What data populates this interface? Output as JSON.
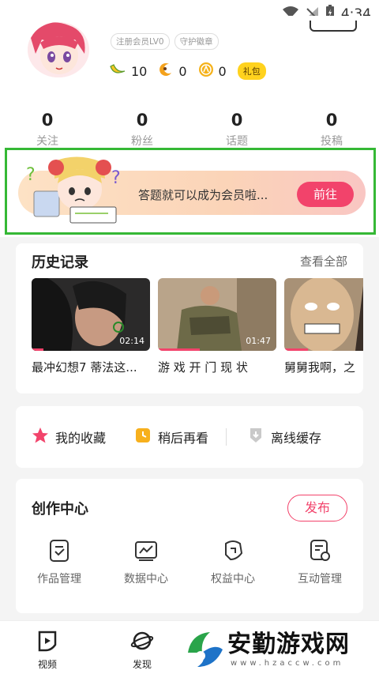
{
  "status": {
    "time": "4:34"
  },
  "profile": {
    "badges": [
      "注册会员LV0",
      "守护徽章"
    ],
    "wallet": [
      {
        "icon": "banana-icon",
        "value": "10"
      },
      {
        "icon": "moon-cake-icon",
        "value": "0"
      },
      {
        "icon": "coin-icon",
        "value": "0"
      }
    ],
    "gift_label": "礼包",
    "stats": [
      {
        "value": "0",
        "label": "关注"
      },
      {
        "value": "0",
        "label": "粉丝"
      },
      {
        "value": "0",
        "label": "话题"
      },
      {
        "value": "0",
        "label": "投稿"
      }
    ]
  },
  "promo": {
    "text": "答题就可以成为会员啦...",
    "button": "前往"
  },
  "history": {
    "title": "历史记录",
    "more": "查看全部",
    "items": [
      {
        "title": "最冲幻想7 蒂法这...",
        "duration": "02:14",
        "progress": 0.1
      },
      {
        "title": "游 戏 开 门 现 状",
        "duration": "01:47",
        "progress": 0.35
      },
      {
        "title": "舅舅我啊，之",
        "duration": "",
        "progress": 0.2
      }
    ]
  },
  "quick": [
    {
      "label": "我的收藏",
      "icon": "star-icon"
    },
    {
      "label": "稍后再看",
      "icon": "clock-icon"
    },
    {
      "label": "离线缓存",
      "icon": "download-icon"
    }
  ],
  "create": {
    "title": "创作中心",
    "publish": "发布",
    "tools": [
      {
        "label": "作品管理",
        "icon": "works-icon"
      },
      {
        "label": "数据中心",
        "icon": "chart-icon"
      },
      {
        "label": "权益中心",
        "icon": "rights-icon"
      },
      {
        "label": "互动管理",
        "icon": "interaction-icon"
      }
    ]
  },
  "tabs": [
    {
      "label": "视频",
      "icon": "video-tab-icon"
    },
    {
      "label": "发现",
      "icon": "planet-tab-icon"
    }
  ],
  "watermark": {
    "title": "安勤游戏网",
    "url": "www.hzaccw.com"
  }
}
